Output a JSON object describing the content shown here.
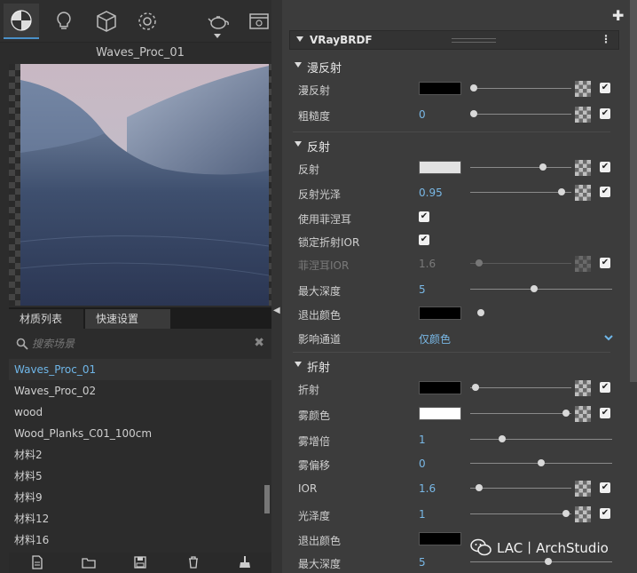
{
  "left_panel": {
    "preview_title": "Waves_Proc_01",
    "tabs": [
      "材质列表",
      "快速设置"
    ],
    "search": {
      "placeholder": "搜索场景"
    },
    "materials": [
      "Waves_Proc_01",
      "Waves_Proc_02",
      "wood",
      "Wood_Planks_C01_100cm",
      "材料2",
      "材料5",
      "材料9",
      "材料12",
      "材料16"
    ],
    "selected_material": "Waves_Proc_01"
  },
  "right_panel": {
    "header": "VRayBRDF",
    "sections": {
      "diffuse": "漫反射",
      "reflection": "反射",
      "refraction": "折射"
    },
    "rows": {
      "diffuse": {
        "label": "漫反射",
        "color": "#000000"
      },
      "roughness": {
        "label": "粗糙度",
        "value": "0",
        "slider": 0.0
      },
      "reflect": {
        "label": "反射",
        "color": "#e2e2e2",
        "slider": 0.85
      },
      "reflect_gloss": {
        "label": "反射光泽",
        "value": "0.95",
        "slider": 0.95
      },
      "use_fresnel": {
        "label": "使用菲涅耳",
        "checked": true
      },
      "lock_ior": {
        "label": "锁定折射IOR",
        "checked": true
      },
      "fresnel_ior": {
        "label": "菲涅耳IOR",
        "value": "1.6",
        "slider": 0.06
      },
      "max_depth": {
        "label": "最大深度",
        "value": "5",
        "slider": 0.45
      },
      "exit_color": {
        "label": "退出颜色",
        "color": "#000000"
      },
      "affect_channels": {
        "label": "影响通道",
        "value": "仅颜色"
      },
      "refract": {
        "label": "折射",
        "color": "#000000"
      },
      "fog_color": {
        "label": "雾颜色",
        "color": "#ffffff",
        "slider": 0.85
      },
      "fog_mult": {
        "label": "雾增倍",
        "value": "1",
        "slider": 0.22
      },
      "fog_bias": {
        "label": "雾偏移",
        "value": "0",
        "slider": 0.5
      },
      "ior": {
        "label": "IOR",
        "value": "1.6",
        "slider": 0.06
      },
      "glossiness": {
        "label": "光泽度",
        "value": "1",
        "slider": 0.98
      },
      "refr_exit_color": {
        "label": "退出颜色",
        "color": "#000000"
      },
      "refr_max_depth": {
        "label": "最大深度",
        "value": "5",
        "slider": 0.55
      }
    }
  },
  "icons": [
    "material-ball-icon",
    "light-bulb-icon",
    "cube-icon",
    "gear-icon",
    "teapot-icon",
    "render-window-icon",
    "search-icon",
    "new-file-icon",
    "open-folder-icon",
    "save-icon",
    "delete-icon",
    "clean-brush-icon",
    "plus-icon",
    "more-icon",
    "chevron-down-icon"
  ],
  "watermark": "LAC丨ArchStudio",
  "colors": {
    "accent_blue": "#6fb6e8",
    "panel_dark": "#2c2c2c",
    "panel": "#3c3c3c"
  }
}
